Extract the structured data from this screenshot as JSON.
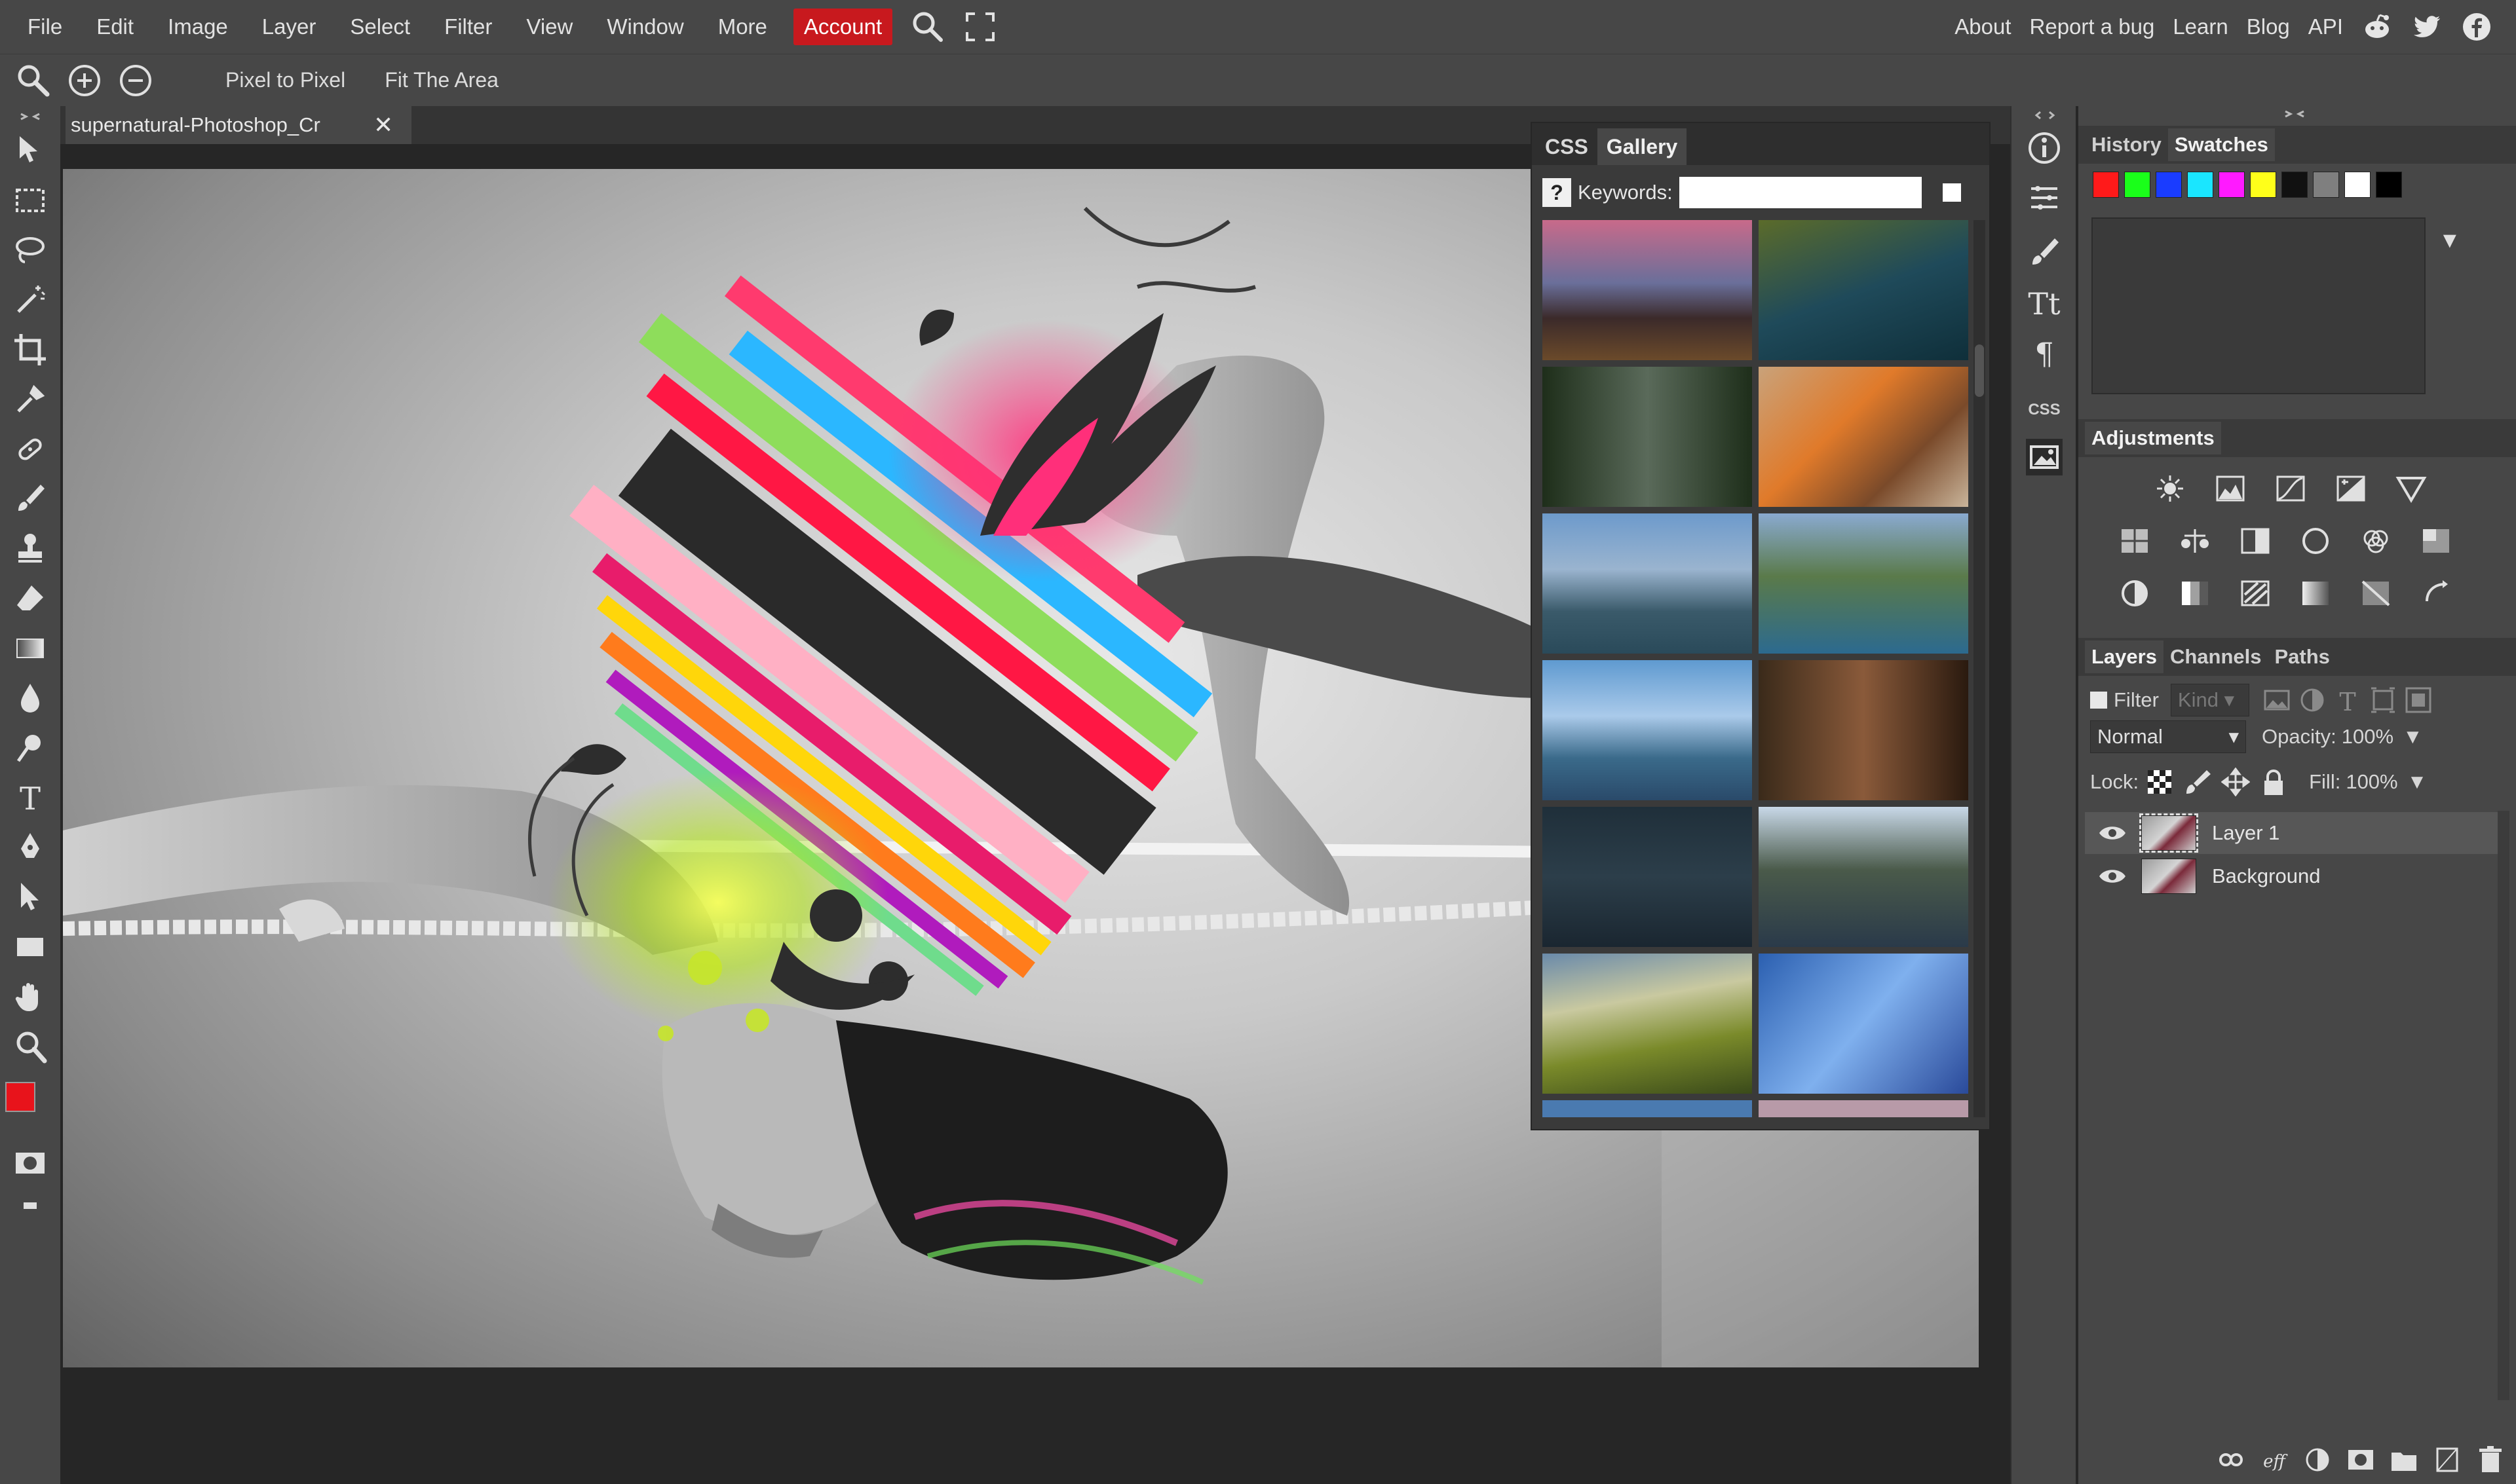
{
  "menu": {
    "items": [
      "File",
      "Edit",
      "Image",
      "Layer",
      "Select",
      "Filter",
      "View",
      "Window",
      "More"
    ],
    "account": "Account",
    "right_links": [
      "About",
      "Report a bug",
      "Learn",
      "Blog",
      "API"
    ],
    "accent_color": "#c8191e"
  },
  "options_bar": {
    "pixel_to_pixel": "Pixel to Pixel",
    "fit_the_area": "Fit The Area"
  },
  "document": {
    "tab_title": "supernatural-Photoshop_Cr",
    "close_glyph": "✕"
  },
  "gallery": {
    "tabs": [
      "CSS",
      "Gallery"
    ],
    "help_glyph": "?",
    "keywords_label": "Keywords:",
    "keywords_value": ""
  },
  "side_column": {
    "css_label": "CSS"
  },
  "right_panel": {
    "history_tabs": [
      "History",
      "Swatches"
    ],
    "swatches": [
      "#ff1a1a",
      "#1aff1a",
      "#1a3cff",
      "#1ae6ff",
      "#ff1aff",
      "#ffff1a",
      "#111111",
      "#7f7f7f",
      "#ffffff",
      "#000000"
    ],
    "adjustments_title": "Adjustments",
    "layers_tabs": [
      "Layers",
      "Channels",
      "Paths"
    ],
    "filter_label": "Filter",
    "filter_kind": "Kind",
    "blend_mode": "Normal",
    "opacity_label": "Opacity:",
    "opacity_value": "100%",
    "lock_label": "Lock:",
    "fill_label": "Fill:",
    "fill_value": "100%",
    "layers": [
      "Layer 1",
      "Background"
    ]
  },
  "colors": {
    "foreground": "#e8131b",
    "background": "#000000"
  }
}
